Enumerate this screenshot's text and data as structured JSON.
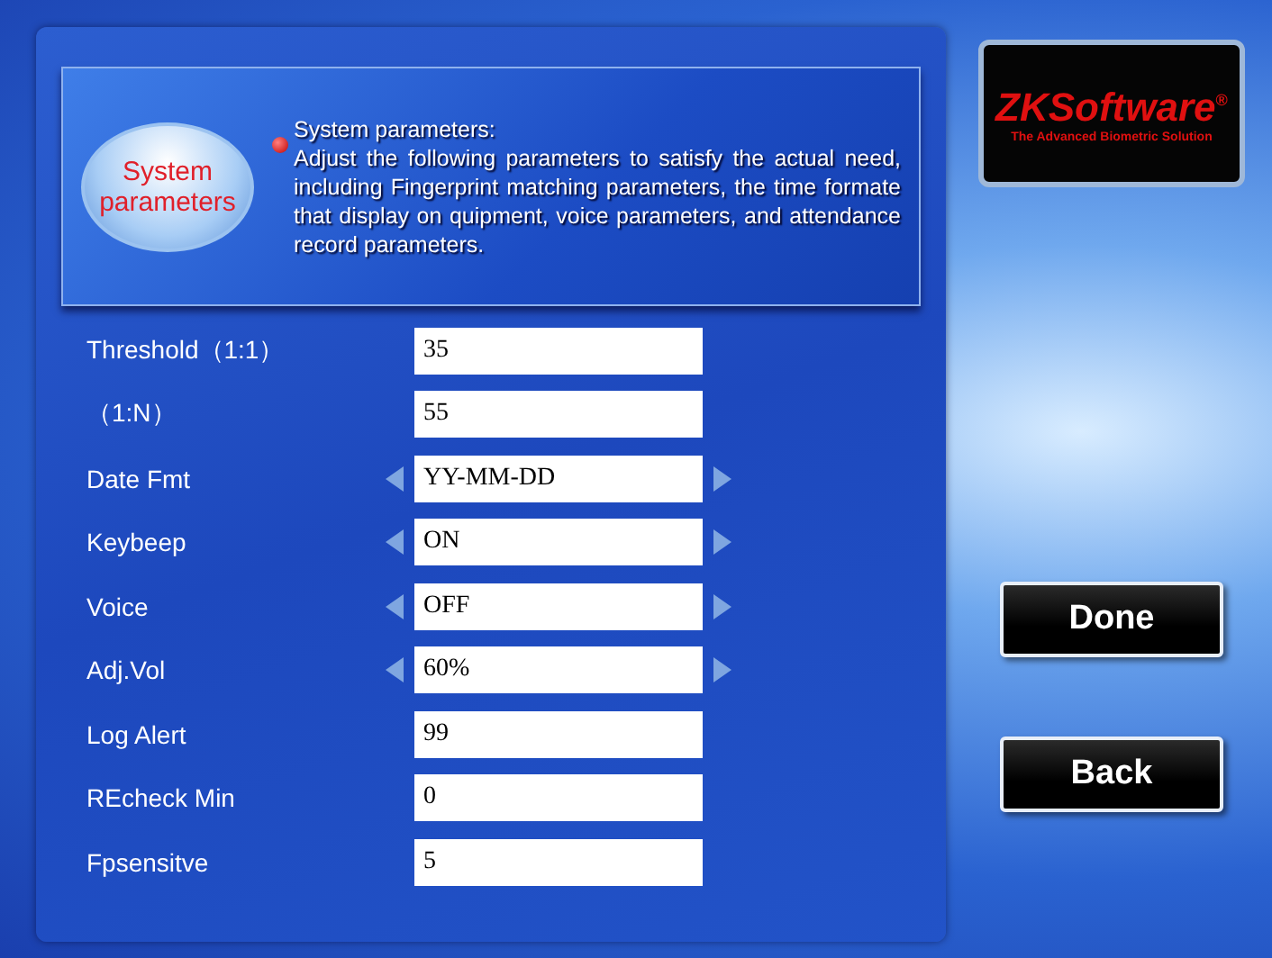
{
  "header": {
    "badge": "System parameters",
    "title": "System parameters:",
    "description": "Adjust the following parameters to satisfy  the actual need, including Fingerprint matching parameters, the time formate that display on quipment, voice parameters, and attendance record parameters."
  },
  "logo": {
    "name": "ZKSoftware",
    "mark": "®",
    "tagline": "The Advanced Biometric Solution"
  },
  "rows": [
    {
      "kind": "text",
      "label": "Threshold（1:1）",
      "value": "35"
    },
    {
      "kind": "text",
      "label": "（1:N）",
      "value": "55"
    },
    {
      "kind": "select",
      "label": "Date Fmt",
      "value": "YY-MM-DD"
    },
    {
      "kind": "select",
      "label": "Keybeep",
      "value": "ON"
    },
    {
      "kind": "select",
      "label": "Voice",
      "value": "OFF"
    },
    {
      "kind": "select",
      "label": "Adj.Vol",
      "value": "60%"
    },
    {
      "kind": "text",
      "label": "Log Alert",
      "value": "99"
    },
    {
      "kind": "text",
      "label": "REcheck Min",
      "value": "0"
    },
    {
      "kind": "text",
      "label": "Fpsensitve",
      "value": "5"
    }
  ],
  "buttons": [
    "Done",
    "Back"
  ]
}
